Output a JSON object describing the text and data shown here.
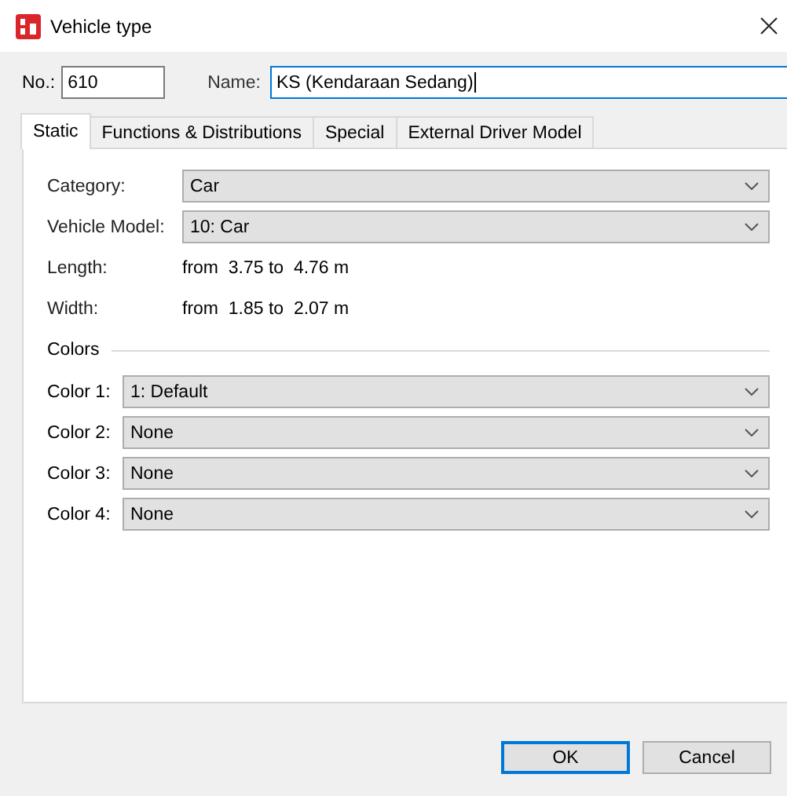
{
  "window": {
    "title": "Vehicle type"
  },
  "header": {
    "number_label": "No.:",
    "number_value": "610",
    "name_label": "Name:",
    "name_value": "KS (Kendaraan Sedang)",
    "name_focused": true
  },
  "tabs": [
    {
      "label": "Static",
      "selected": true
    },
    {
      "label": "Functions & Distributions",
      "selected": false
    },
    {
      "label": "Special",
      "selected": false
    },
    {
      "label": "External Driver Model",
      "selected": false
    }
  ],
  "properties": [
    {
      "kind": "dropdown",
      "label": "Category:",
      "value": "Car"
    },
    {
      "kind": "dropdown",
      "label": "Vehicle Model:",
      "value": "10: Car"
    },
    {
      "kind": "text",
      "label": "Length:",
      "value": "from  3.75 to  4.76 m"
    },
    {
      "kind": "text",
      "label": "Width:",
      "value": "from  1.85 to  2.07 m"
    }
  ],
  "colors": {
    "title": "Colors",
    "rows": [
      {
        "label": "Color 1:",
        "value": "1: Default"
      },
      {
        "label": "Color 2:",
        "value": "None"
      },
      {
        "label": "Color 3:",
        "value": "None"
      },
      {
        "label": "Color 4:",
        "value": "None"
      }
    ]
  },
  "buttons": [
    {
      "label": "OK",
      "default": true
    },
    {
      "label": "Cancel",
      "default": false
    }
  ]
}
